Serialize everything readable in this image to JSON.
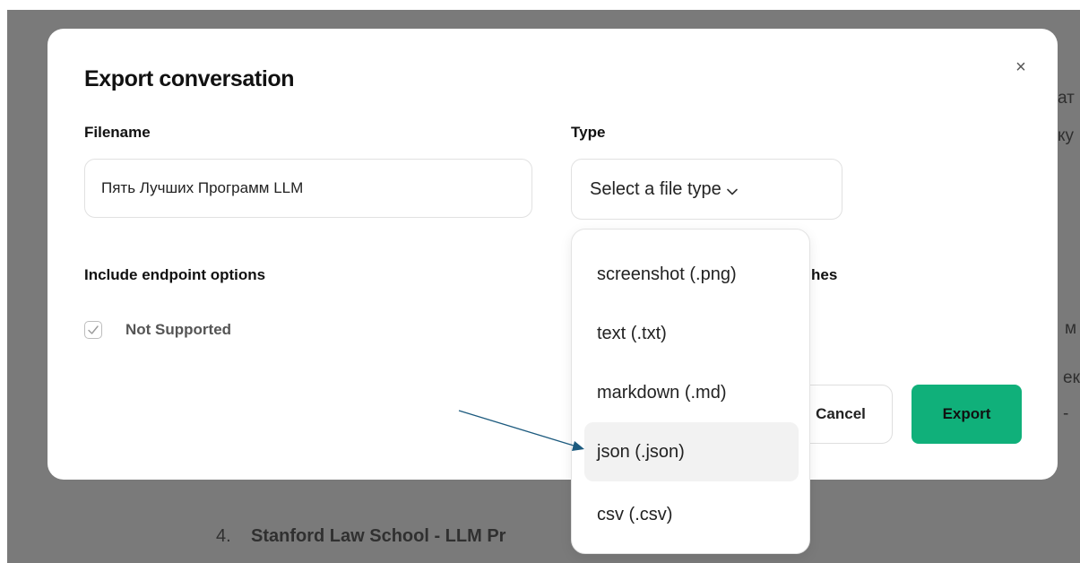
{
  "background": {
    "right_fragments": [
      "ат",
      "ку",
      "м",
      "ек",
      "-"
    ],
    "list_item_number": "4.",
    "list_item_text": "Stanford Law School - LLM Pr"
  },
  "modal": {
    "title": "Export conversation",
    "close_icon": "×",
    "filename_label": "Filename",
    "filename_value": "Пять Лучших Программ LLM",
    "type_label": "Type",
    "type_placeholder": "Select a file type",
    "endpoint_label": "Include endpoint options",
    "endpoint_checkbox_label": "Not Supported",
    "partial_label": "hes",
    "cancel_label": "Cancel",
    "export_label": "Export"
  },
  "dropdown": {
    "options": [
      "screenshot (.png)",
      "text (.txt)",
      "markdown (.md)",
      "json (.json)",
      "csv (.csv)"
    ],
    "highlighted_option": "json (.json)"
  },
  "colors": {
    "export_button": "#10b07a",
    "arrow": "#1c5a7e",
    "backdrop": "#7a7a7a"
  },
  "icons": [
    "close-icon",
    "chevron-down-icon",
    "checkmark-icon",
    "arrow-annotation-icon"
  ]
}
